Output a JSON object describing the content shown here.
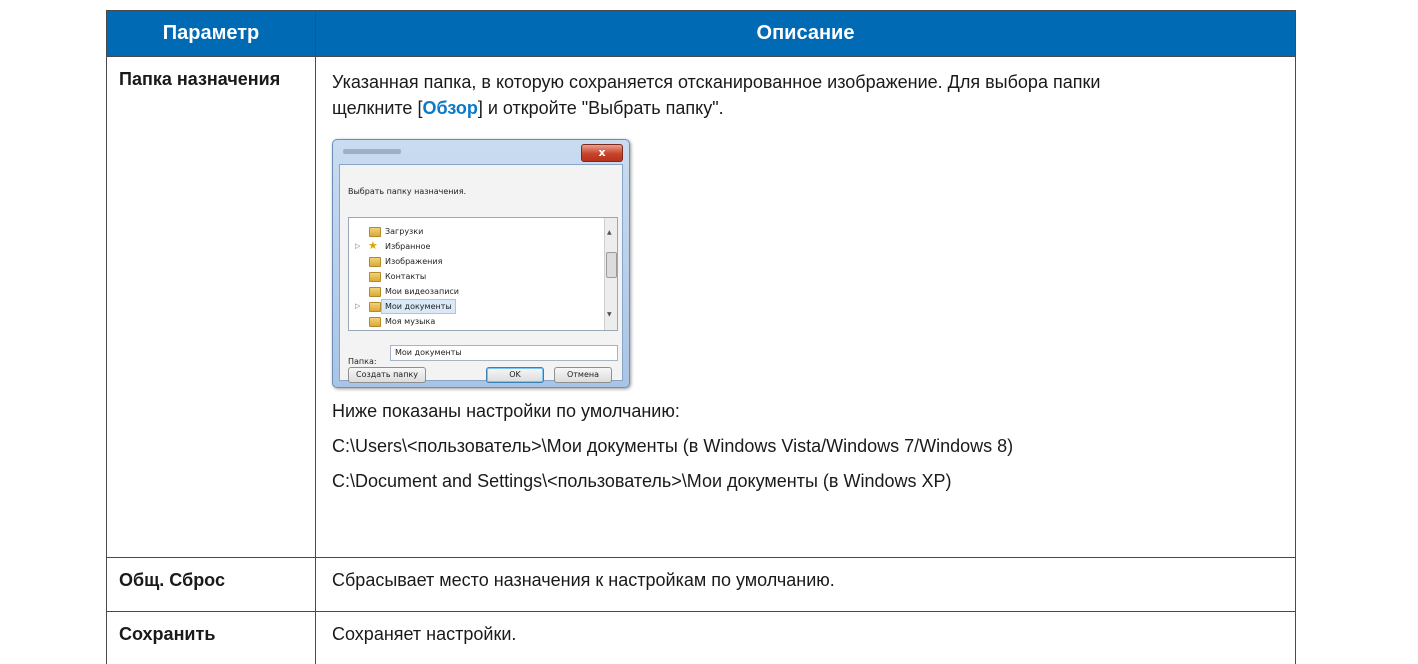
{
  "table": {
    "headers": [
      "Параметр",
      "Описание"
    ],
    "rows": {
      "destination": {
        "name": "Папка назначения",
        "desc_line1": "Указанная папка, в которую сохраняется отсканированное изображение. Для выбора папки",
        "desc_line2_prefix": "щелкните [",
        "browse_label": "Обзор",
        "desc_line2_suffix": "] и откройте \"Выбрать папку\".",
        "defaults_intro": "Ниже показаны настройки по умолчанию:",
        "default_path_new": "C:\\Users\\<пользователь>\\Мои документы (в Windows Vista/Windows 7/Windows 8)",
        "default_path_xp": "C:\\Document and Settings\\<пользователь>\\Мои документы (в Windows XP)"
      },
      "reset": {
        "name": "Общ. Сброс",
        "desc": "Сбрасывает место назначения к настройкам по умолчанию."
      },
      "save": {
        "name": "Сохранить",
        "desc": "Сохраняет настройки."
      }
    }
  },
  "dialog": {
    "close_glyph": "x",
    "prompt": "Выбрать папку назначения.",
    "tree_items": [
      "Загрузки",
      "Избранное",
      "Изображения",
      "Контакты",
      "Мои видеозаписи",
      "Мои документы",
      "Моя музыка"
    ],
    "selected_item": "Мои документы",
    "folder_label": "Папка:",
    "folder_value": "Мои документы",
    "create_folder_button": "Создать папку",
    "ok_button": "OK",
    "cancel_button": "Отмена"
  },
  "colors": {
    "header_bg": "#006ab4",
    "header_text": "#ffffff",
    "link": "#0a7ac8"
  }
}
